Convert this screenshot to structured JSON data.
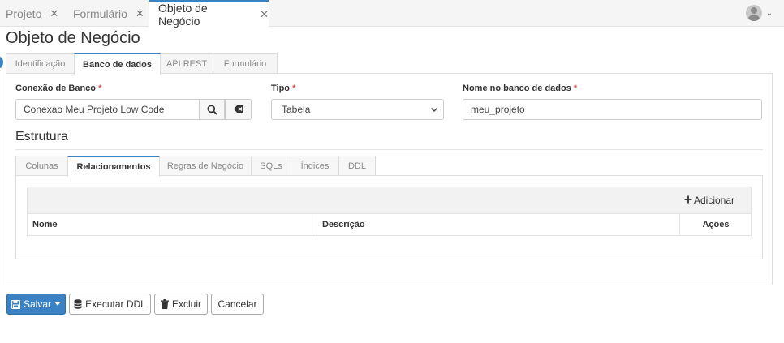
{
  "top_tabs": [
    {
      "label": "Projeto",
      "close": "✕"
    },
    {
      "label": "Formulário",
      "close": "✕"
    },
    {
      "label": "Objeto de Negócio",
      "close": "✕"
    }
  ],
  "user": {
    "chevron": "⌄"
  },
  "page_title": "Objeto de Negócio",
  "main_tabs": [
    "Identificação",
    "Banco de dados",
    "API REST",
    "Formulário"
  ],
  "form": {
    "conexao_label": "Conexão de Banco",
    "conexao_value": "Conexao Meu Projeto Low Code",
    "tipo_label": "Tipo",
    "tipo_value": "Tabela",
    "nome_label": "Nome no banco de dados",
    "nome_value": "meu_projeto",
    "required_mark": "*"
  },
  "estrutura": {
    "title": "Estrutura",
    "tabs": [
      "Colunas",
      "Relacionamentos",
      "Regras de Negócio",
      "SQLs",
      "Índices",
      "DDL"
    ],
    "add_label": "Adicionar",
    "columns": [
      "Nome",
      "Descrição",
      "Ações"
    ]
  },
  "actions": {
    "save": "Salvar",
    "execute_ddl": "Executar DDL",
    "delete": "Excluir",
    "cancel": "Cancelar"
  },
  "colors": {
    "accent": "#3b82c4",
    "required": "#d9534f"
  }
}
